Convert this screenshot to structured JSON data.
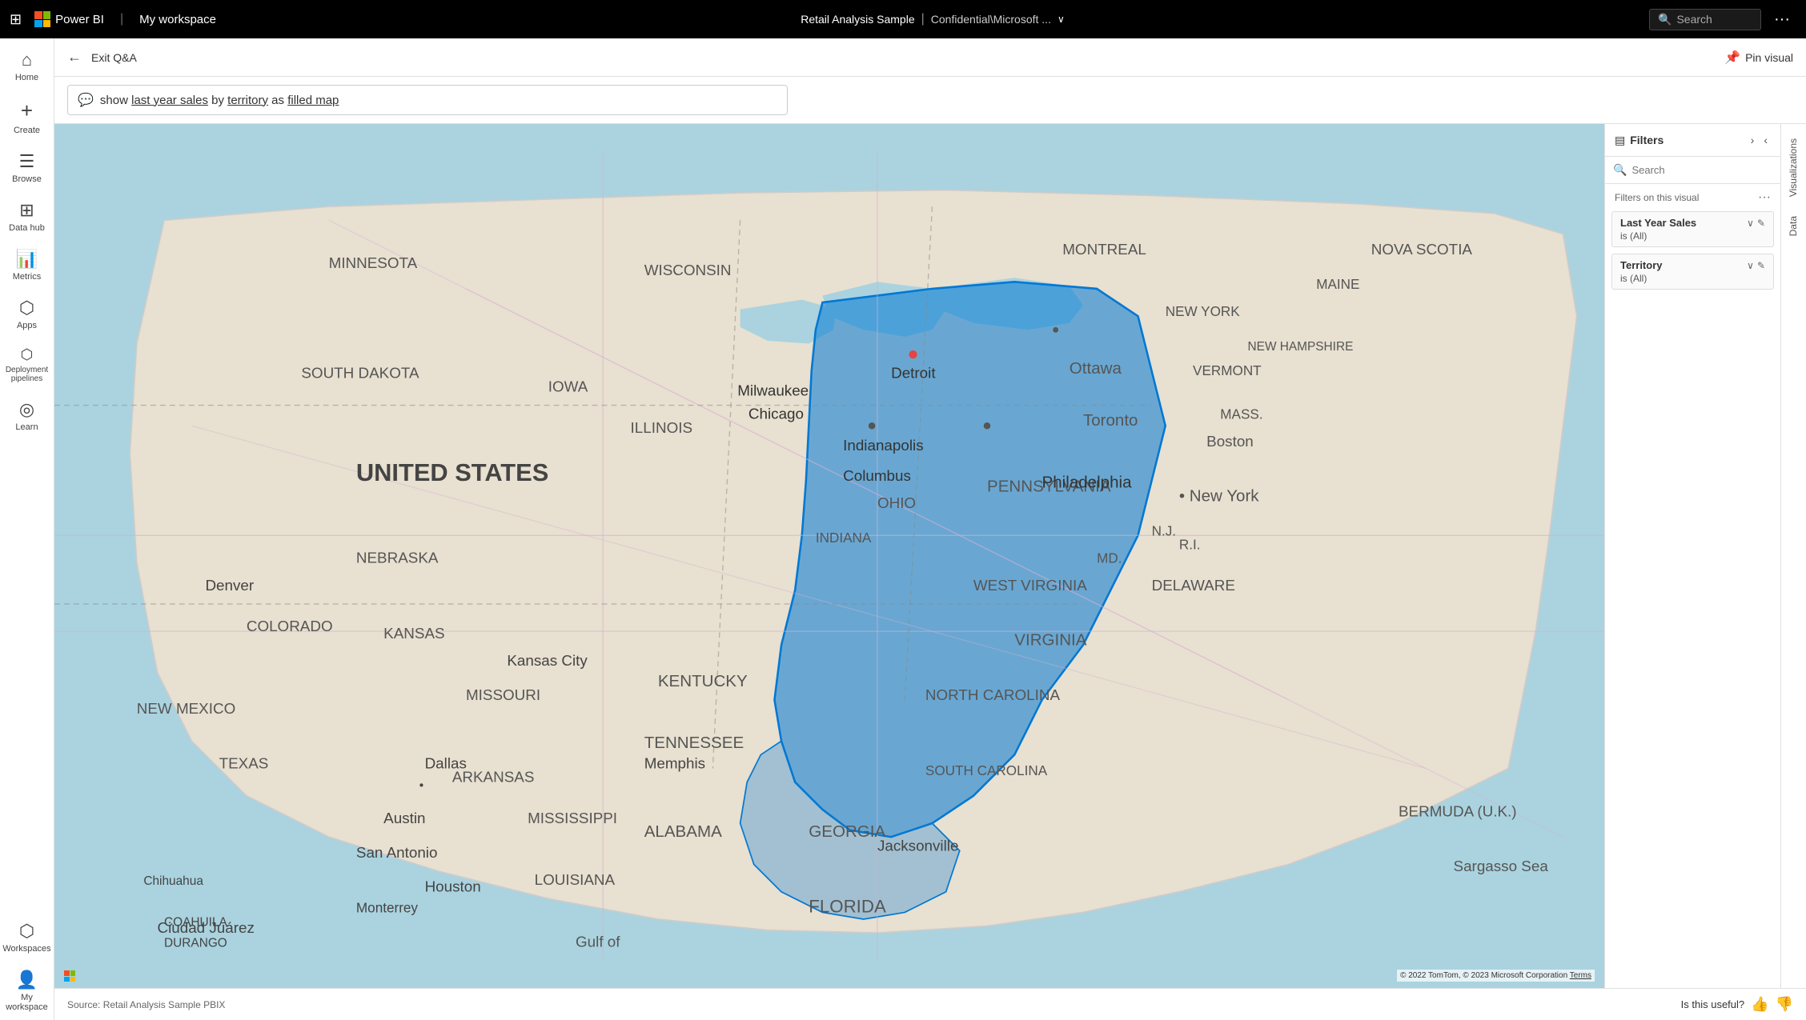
{
  "topNav": {
    "gridIcon": "⊞",
    "brandName": "Power BI",
    "workspaceName": "My workspace",
    "reportTitle": "Retail Analysis Sample",
    "reportSub": "Confidential\\Microsoft ...",
    "searchPlaceholder": "Search",
    "moreIcon": "···"
  },
  "sidebar": {
    "items": [
      {
        "id": "home",
        "label": "Home",
        "icon": "⌂"
      },
      {
        "id": "create",
        "label": "Create",
        "icon": "+"
      },
      {
        "id": "browse",
        "label": "Browse",
        "icon": "☰"
      },
      {
        "id": "datahub",
        "label": "Data hub",
        "icon": "⊞"
      },
      {
        "id": "metrics",
        "label": "Metrics",
        "icon": "▦"
      },
      {
        "id": "apps",
        "label": "Apps",
        "icon": "⬡"
      },
      {
        "id": "deployment",
        "label": "Deployment pipelines",
        "icon": "⬡"
      },
      {
        "id": "learn",
        "label": "Learn",
        "icon": "◎"
      },
      {
        "id": "workspaces",
        "label": "Workspaces",
        "icon": "⬡"
      },
      {
        "id": "my-workspace",
        "label": "My workspace",
        "icon": "⬡"
      }
    ]
  },
  "toolbar": {
    "backIcon": "←",
    "exitQALabel": "Exit Q&A",
    "pinIcon": "📌",
    "pinVisualLabel": "Pin visual"
  },
  "qaBar": {
    "icon": "💬",
    "textBefore": "show ",
    "link1": "last year sales",
    "textMid": " by ",
    "link2": "territory",
    "textAfter": " as ",
    "link3": "filled map"
  },
  "filtersPanel": {
    "title": "Filters",
    "filterIcon": "▤",
    "arrowRight": "›",
    "arrowLeft": "‹",
    "searchPlaceholder": "Search",
    "sectionLabel": "Filters on this visual",
    "moreIcon": "···",
    "filters": [
      {
        "title": "Last Year Sales",
        "value": "is (All)",
        "chevron": "∨",
        "edit": "✎"
      },
      {
        "title": "Territory",
        "value": "is (All)",
        "chevron": "∨",
        "edit": "✎"
      }
    ]
  },
  "rightTabs": [
    {
      "id": "visualizations",
      "label": "Visualizations",
      "active": false
    },
    {
      "id": "data",
      "label": "Data",
      "active": false
    }
  ],
  "footer": {
    "source": "Source: Retail Analysis Sample PBIX",
    "usefulLabel": "Is this useful?",
    "thumbUp": "👍",
    "thumbDown": "👎"
  },
  "map": {
    "attribution": "© 2022 TomTom, © 2023 Microsoft Corporation  Terms",
    "logo": "Microsoft/Bing Maps logo"
  }
}
